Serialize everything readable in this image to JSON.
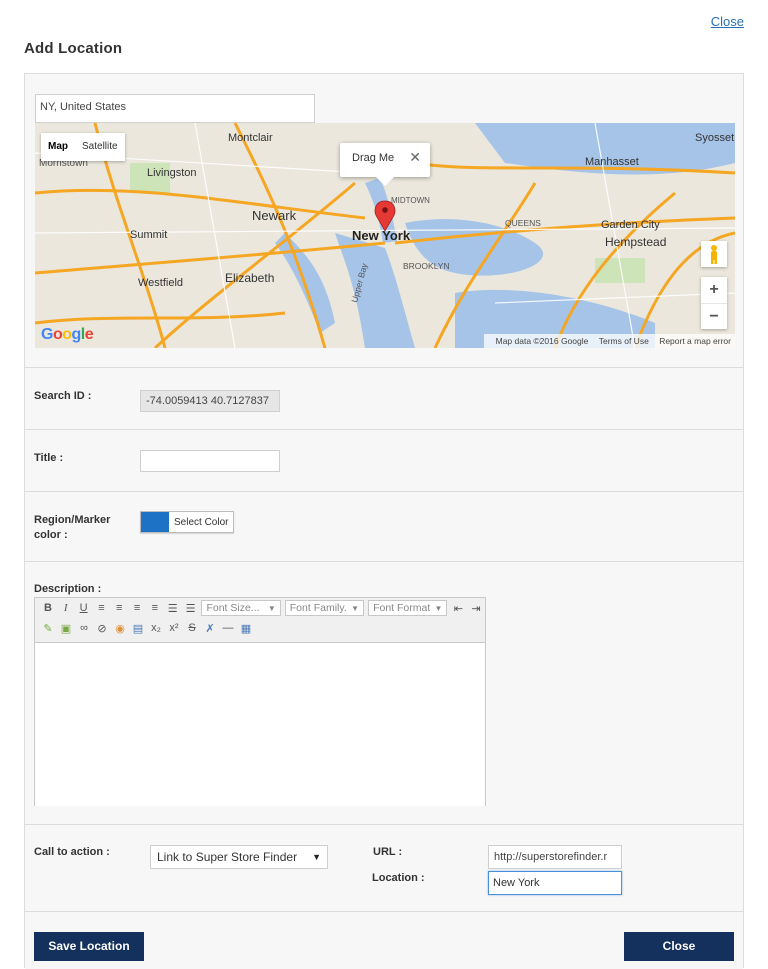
{
  "header": {
    "close_link": "Close",
    "title": "Add Location"
  },
  "search": {
    "value": "NY, United States"
  },
  "map": {
    "type_map": "Map",
    "type_satellite": "Satellite",
    "marker_bubble": "Drag Me",
    "bubble_close": "✕",
    "zoom_in": "+",
    "zoom_out": "−",
    "footer_data": "Map data ©2016 Google",
    "footer_terms": "Terms of Use",
    "footer_report": "Report a map error",
    "logo": "Google",
    "labels": [
      "Montclair",
      "Livingston",
      "Newark",
      "Summit",
      "Westfield",
      "Elizabeth",
      "New York",
      "BROOKLYN",
      "QUEENS",
      "MIDTOWN",
      "Manhasset",
      "Garden City",
      "Hempstead",
      "Syosset",
      "Upper Bay",
      "Morristown"
    ]
  },
  "form": {
    "search_id_label": "Search ID :",
    "search_id_value": "-74.0059413 40.7127837",
    "title_label": "Title :",
    "color_label_1": "Region/Marker",
    "color_label_2": "color :",
    "color_button": "Select Color",
    "swatch_color": "#1e72c5",
    "description_label": "Description :",
    "font_size": "Font Size...",
    "font_family": "Font Family.",
    "font_format": "Font Format",
    "cta_label": "Call to action :",
    "cta_value": "Link to Super Store Finder",
    "url_label": "URL :",
    "url_value": "http://superstorefinder.r",
    "location_label": "Location :",
    "location_value": "New York"
  },
  "footer": {
    "save": "Save Location",
    "close": "Close"
  }
}
